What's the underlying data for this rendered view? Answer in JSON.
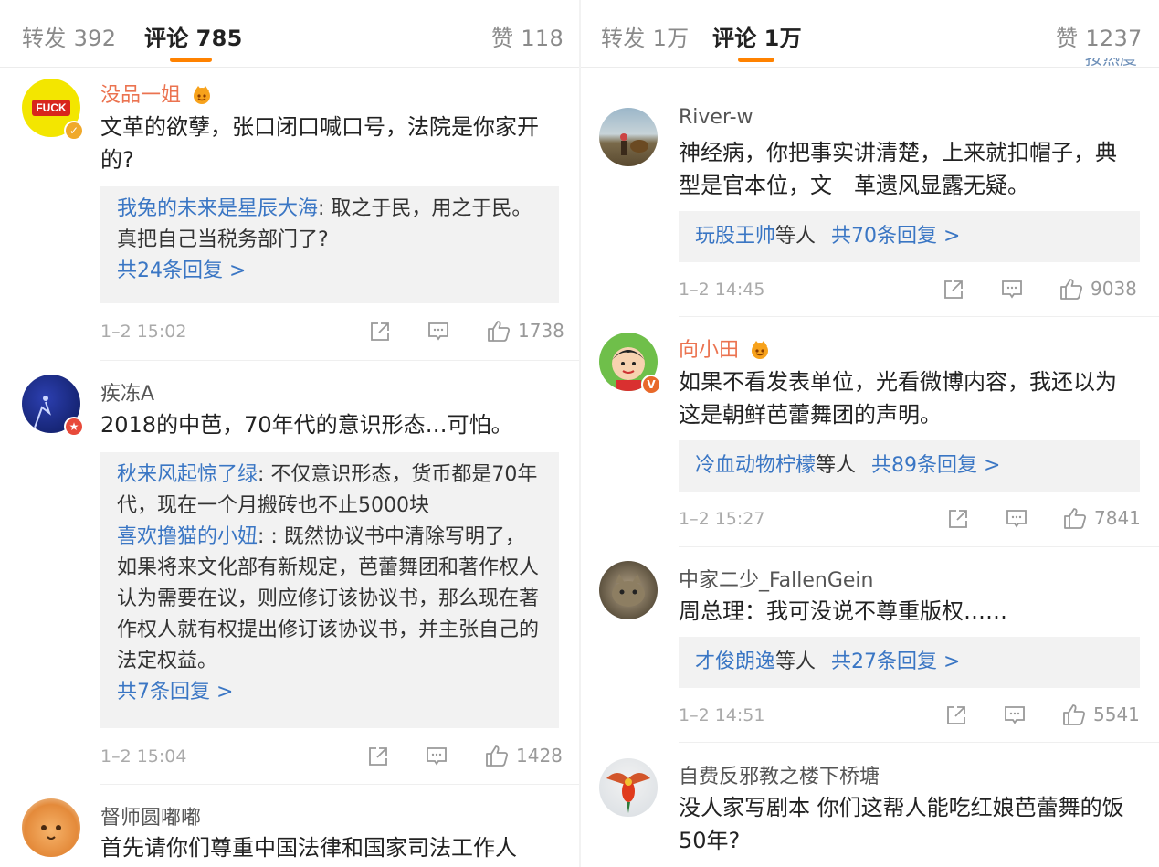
{
  "left": {
    "tabs": {
      "repost_label": "转发",
      "repost_count": "392",
      "comment_label": "评论",
      "comment_count": "785",
      "like_label": "赞",
      "like_count": "118"
    },
    "comments": [
      {
        "username": "没品一姐",
        "avatar_text": "FUCK",
        "text": "文革的欲孽，张口闭口喊口号，法院是你家开的?",
        "replies": [
          {
            "name": "我兔的未来是星辰大海",
            "text": ": 取之于民，用之于民。真把自己当税务部门了?"
          }
        ],
        "more": "共24条回复 >",
        "time": "1–2 15:02",
        "likes": "1738"
      },
      {
        "username": "疾冻A",
        "text": "2018的中芭，70年代的意识形态…可怕。",
        "replies": [
          {
            "name": "秋来风起惊了绿",
            "text": ": 不仅意识形态，货币都是70年代，现在一个月搬砖也不止5000块"
          },
          {
            "name": "喜欢撸猫的小妞",
            "text": ": : 既然协议书中清除写明了，如果将来文化部有新规定，芭蕾舞团和著作权人认为需要在议，则应修订该协议书，那么现在著作权人就有权提出修订该协议书，并主张自己的法定权益。"
          }
        ],
        "more": "共7条回复 >",
        "time": "1–2 15:04",
        "likes": "1428"
      },
      {
        "username": "督师圆嘟嘟",
        "text": "首先请你们尊重中国法律和国家司法工作人"
      }
    ]
  },
  "right": {
    "tabs": {
      "repost_label": "转发",
      "repost_count": "1万",
      "comment_label": "评论",
      "comment_count": "1万",
      "like_label": "赞",
      "like_count": "1237"
    },
    "sort_label": "按热度",
    "comments": [
      {
        "username": "River-w",
        "text": "神经病，你把事实讲清楚，上来就扣帽子，典型是官本位，文　革遗风显露无疑。",
        "reply_name": "玩股王帅",
        "reply_suffix": "等人",
        "more": "共70条回复 >",
        "time": "1–2 14:45",
        "likes": "9038"
      },
      {
        "username": "向小田",
        "text": "如果不看发表单位，光看微博内容，我还以为这是朝鲜芭蕾舞团的声明。",
        "reply_name": "冷血动物柠檬",
        "reply_suffix": "等人",
        "more": "共89条回复 >",
        "time": "1–2 15:27",
        "likes": "7841"
      },
      {
        "username": "中家二少_FallenGein",
        "text": "周总理：我可没说不尊重版权……",
        "reply_name": "才俊朗逸",
        "reply_suffix": "等人",
        "more": "共27条回复 >",
        "time": "1–2 14:51",
        "likes": "5541"
      },
      {
        "username": "自费反邪教之楼下桥塘",
        "text": "没人家写剧本 你们这帮人能吃红娘芭蕾舞的饭50年?"
      }
    ]
  },
  "colors": {
    "accent": "#ff8200",
    "link": "#3a76c4",
    "username_vip": "#eb7350",
    "reply_bg": "#f2f2f2",
    "meta": "#aaaaaa"
  }
}
